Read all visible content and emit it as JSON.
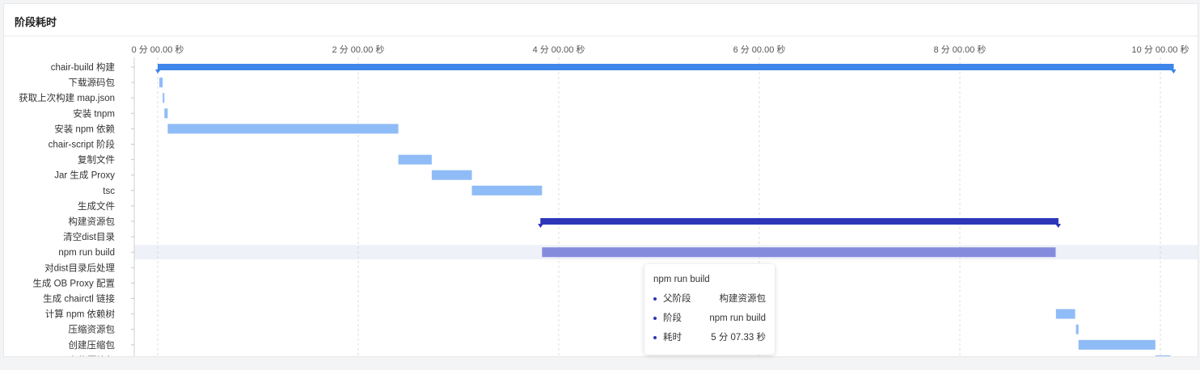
{
  "panel": {
    "title": "阶段耗时"
  },
  "chart_data": {
    "type": "gantt",
    "x_unit": "seconds",
    "xlim": [
      0,
      610
    ],
    "x_ticks": [
      {
        "value": 0,
        "label": "0 分 00.00 秒"
      },
      {
        "value": 120,
        "label": "2 分 00.00 秒"
      },
      {
        "value": 240,
        "label": "4 分 00.00 秒"
      },
      {
        "value": 360,
        "label": "6 分 00.00 秒"
      },
      {
        "value": 480,
        "label": "8 分 00.00 秒"
      },
      {
        "value": 600,
        "label": "10 分 00.00 秒"
      }
    ],
    "grid": true,
    "colors": {
      "group_primary": "#3e86ea",
      "group_secondary": "#2d36b8",
      "task": "#8fbcf6",
      "task_selected": "#858bdc",
      "highlight_row": "#eef1f8"
    },
    "rows": [
      {
        "label": "chair-build 构建",
        "start": 0,
        "end": 608,
        "kind": "group_primary"
      },
      {
        "label": "下载源码包",
        "start": 1,
        "end": 3,
        "kind": "task"
      },
      {
        "label": "获取上次构建 map.json",
        "start": 3,
        "end": 4,
        "kind": "task"
      },
      {
        "label": "安装 tnpm",
        "start": 4,
        "end": 6,
        "kind": "task"
      },
      {
        "label": "安装 npm 依赖",
        "start": 6,
        "end": 144,
        "kind": "task"
      },
      {
        "label": "chair-script 阶段",
        "start": null,
        "end": null,
        "kind": "none"
      },
      {
        "label": "复制文件",
        "start": 144,
        "end": 164,
        "kind": "task"
      },
      {
        "label": "Jar 生成 Proxy",
        "start": 164,
        "end": 188,
        "kind": "task"
      },
      {
        "label": "tsc",
        "start": 188,
        "end": 230,
        "kind": "task"
      },
      {
        "label": "生成文件",
        "start": null,
        "end": null,
        "kind": "none"
      },
      {
        "label": "构建资源包",
        "start": 229,
        "end": 539,
        "kind": "group_secondary"
      },
      {
        "label": "清空dist目录",
        "start": null,
        "end": null,
        "kind": "none"
      },
      {
        "label": "npm run build",
        "start": 230,
        "end": 537.33,
        "kind": "task_selected",
        "highlight": true
      },
      {
        "label": "对dist目录后处理",
        "start": null,
        "end": null,
        "kind": "none"
      },
      {
        "label": "生成 OB Proxy 配置",
        "start": null,
        "end": null,
        "kind": "none"
      },
      {
        "label": "生成 chairctl 链接",
        "start": null,
        "end": null,
        "kind": "none"
      },
      {
        "label": "计算 npm 依赖树",
        "start": 537.5,
        "end": 549,
        "kind": "task"
      },
      {
        "label": "压缩资源包",
        "start": 549.5,
        "end": 551,
        "kind": "task"
      },
      {
        "label": "创建压缩包",
        "start": 551,
        "end": 597,
        "kind": "task"
      },
      {
        "label": "上传压缩包",
        "start": 597,
        "end": 606,
        "kind": "task"
      }
    ]
  },
  "tooltip": {
    "title": "npm run build",
    "rows": [
      {
        "key": "父阶段",
        "value": "构建资源包"
      },
      {
        "key": "阶段",
        "value": "npm run build"
      },
      {
        "key": "耗时",
        "value": "5 分 07.33 秒"
      }
    ]
  }
}
